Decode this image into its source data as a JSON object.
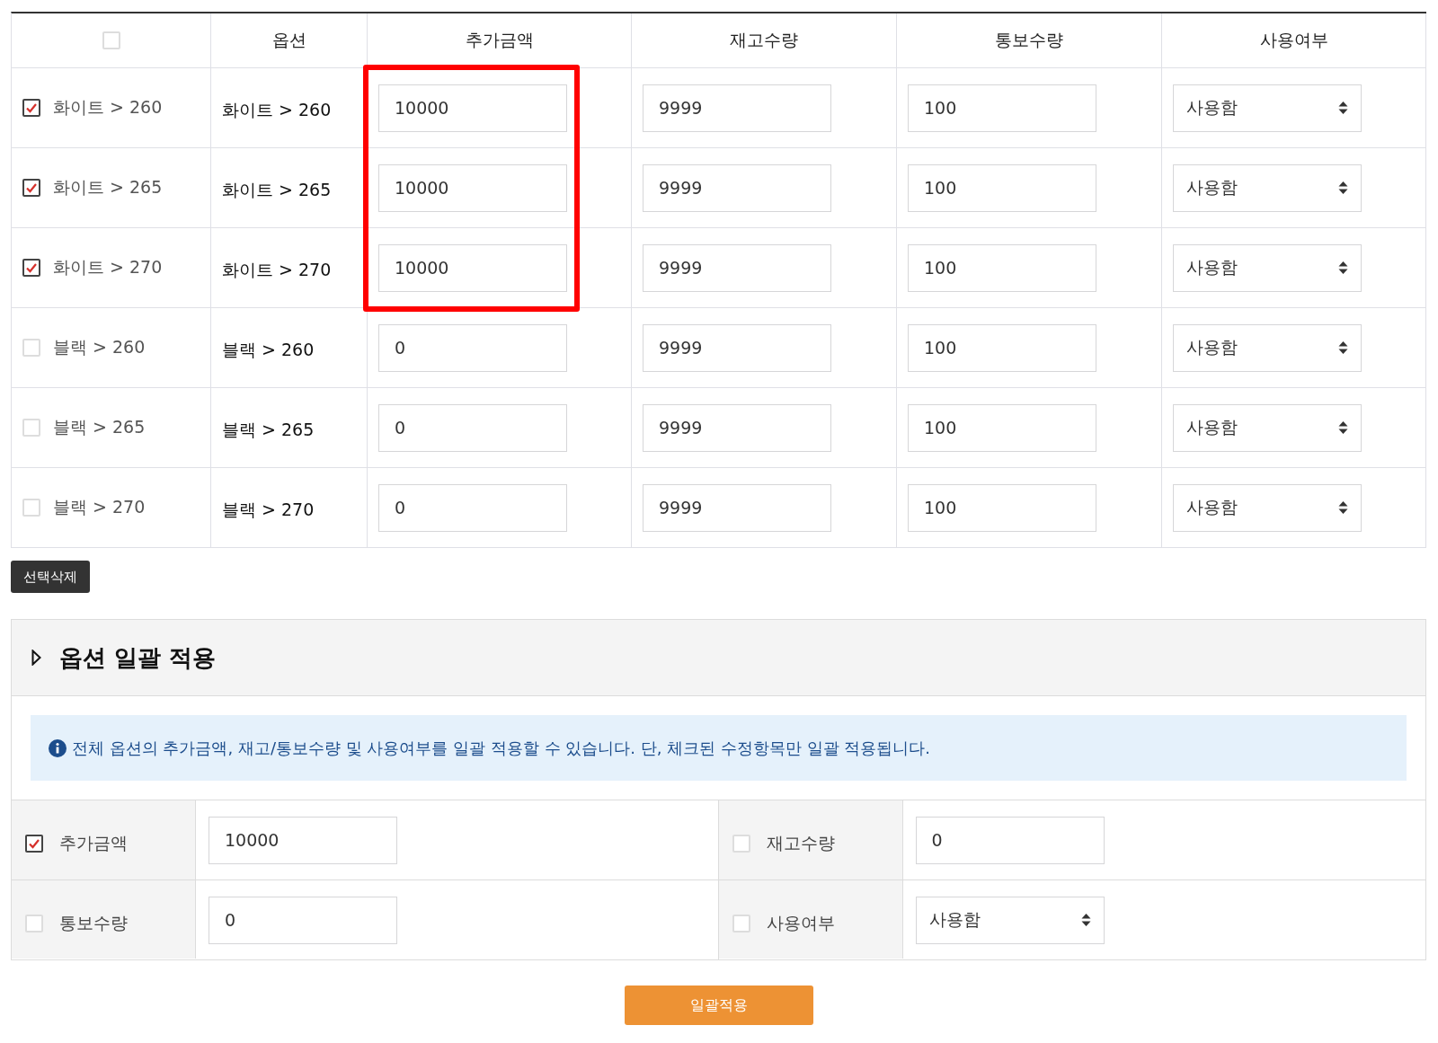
{
  "table": {
    "select_all": {
      "checked": false
    },
    "columns": [
      "옵션",
      "추가금액",
      "재고수량",
      "통보수량",
      "사용여부"
    ],
    "rows": [
      {
        "checked": true,
        "label": "화이트 > 260",
        "option": "화이트 > 260",
        "amount": "10000",
        "stock": "9999",
        "notify": "100",
        "usage": "사용함",
        "highlighted": true
      },
      {
        "checked": true,
        "label": "화이트 > 265",
        "option": "화이트 > 265",
        "amount": "10000",
        "stock": "9999",
        "notify": "100",
        "usage": "사용함",
        "highlighted": true
      },
      {
        "checked": true,
        "label": "화이트 > 270",
        "option": "화이트 > 270",
        "amount": "10000",
        "stock": "9999",
        "notify": "100",
        "usage": "사용함",
        "highlighted": true
      },
      {
        "checked": false,
        "label": "블랙 > 260",
        "option": "블랙 > 260",
        "amount": "0",
        "stock": "9999",
        "notify": "100",
        "usage": "사용함",
        "highlighted": false
      },
      {
        "checked": false,
        "label": "블랙 > 265",
        "option": "블랙 > 265",
        "amount": "0",
        "stock": "9999",
        "notify": "100",
        "usage": "사용함",
        "highlighted": false
      },
      {
        "checked": false,
        "label": "블랙 > 270",
        "option": "블랙 > 270",
        "amount": "0",
        "stock": "9999",
        "notify": "100",
        "usage": "사용함",
        "highlighted": false
      }
    ]
  },
  "delete_button": "선택삭제",
  "bulk": {
    "title": "옵션 일괄 적용",
    "notice": "전체 옵션의 추가금액, 재고/통보수량 및 사용여부를 일괄 적용할 수 있습니다. 단, 체크된 수정항목만 일괄 적용됩니다.",
    "fields": [
      {
        "kind": "input",
        "label": "추가금액",
        "checked": true,
        "value": "10000"
      },
      {
        "kind": "input",
        "label": "재고수량",
        "checked": false,
        "value": "0"
      },
      {
        "kind": "input",
        "label": "통보수량",
        "checked": false,
        "value": "0"
      },
      {
        "kind": "select",
        "label": "사용여부",
        "checked": false,
        "value": "사용함"
      }
    ],
    "apply_button": "일괄적용"
  }
}
